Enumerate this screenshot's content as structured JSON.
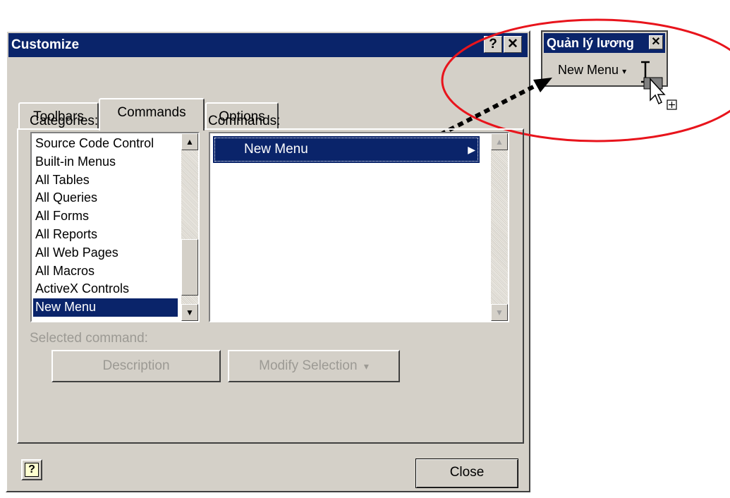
{
  "dialog": {
    "title": "Customize",
    "help_button": "?",
    "close_button": "✕"
  },
  "tabs": [
    {
      "label": "Toolbars",
      "active": false
    },
    {
      "label": "Commands",
      "active": true
    },
    {
      "label": "Options",
      "active": false
    }
  ],
  "categories": {
    "label": "Categories:",
    "items": [
      "Source Code Control",
      "Built-in Menus",
      "All Tables",
      "All Queries",
      "All Forms",
      "All Reports",
      "All Web Pages",
      "All Macros",
      "ActiveX Controls",
      "New Menu"
    ],
    "selected": "New Menu"
  },
  "commands": {
    "label": "Commands:",
    "items": [
      "New Menu"
    ],
    "selected": "New Menu"
  },
  "selected_command": {
    "label": "Selected command:",
    "description_button": "Description",
    "modify_button": "Modify Selection",
    "modify_arrow": "▾"
  },
  "footer": {
    "help_icon_text": "?",
    "close_button": "Close"
  },
  "toolbar": {
    "title": "Quản lý lương",
    "close": "✕",
    "menu_label": "New Menu"
  },
  "colors": {
    "titlebar": "#0a246a",
    "dialog_face": "#d4d0c8",
    "annotation": "#e8141c"
  }
}
